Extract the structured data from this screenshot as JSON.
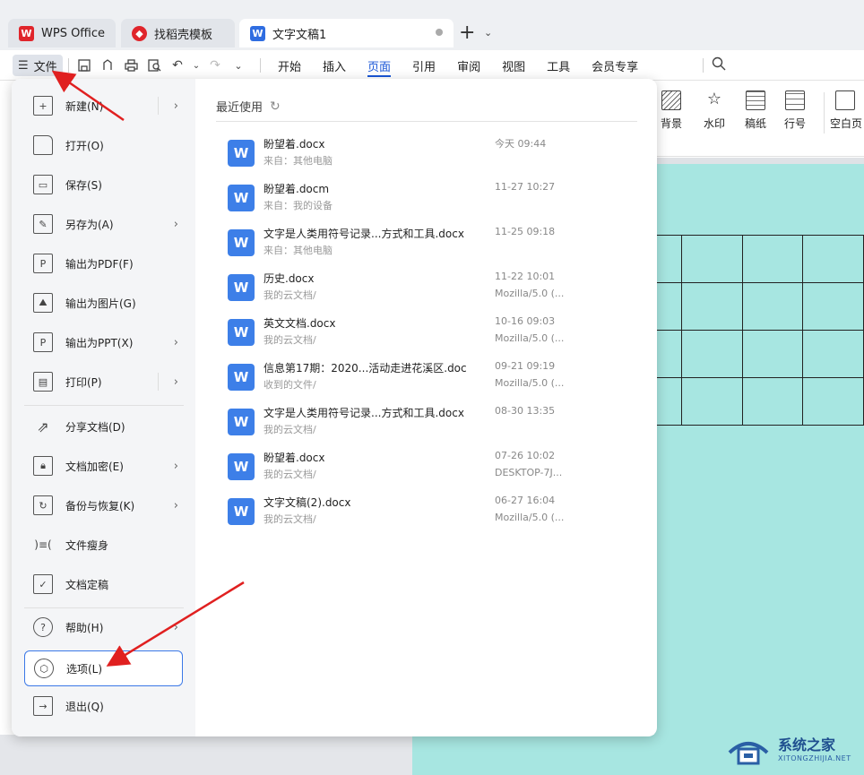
{
  "tabs": [
    {
      "label": "WPS Office",
      "icon": "wps-logo-icon"
    },
    {
      "label": "找稻壳模板",
      "icon": "docer-icon"
    },
    {
      "label": "文字文稿1",
      "icon": "word-doc-icon"
    }
  ],
  "menubar": {
    "file_label": "文件",
    "tabs": [
      "开始",
      "插入",
      "页面",
      "引用",
      "审阅",
      "视图",
      "工具",
      "会员专享"
    ],
    "active_tab": "页面"
  },
  "ribbon": {
    "buttons": [
      "背景",
      "水印",
      "稿纸",
      "行号",
      "空白页"
    ]
  },
  "file_menu": {
    "items": [
      {
        "label": "新建(N)",
        "icon": "new-file-icon",
        "submenu": true
      },
      {
        "label": "打开(O)",
        "icon": "folder-open-icon",
        "submenu": false
      },
      {
        "label": "保存(S)",
        "icon": "save-icon",
        "submenu": false
      },
      {
        "label": "另存为(A)",
        "icon": "save-as-icon",
        "submenu": true
      },
      {
        "label": "输出为PDF(F)",
        "icon": "export-pdf-icon",
        "submenu": false
      },
      {
        "label": "输出为图片(G)",
        "icon": "export-image-icon",
        "submenu": false
      },
      {
        "label": "输出为PPT(X)",
        "icon": "export-ppt-icon",
        "submenu": true
      },
      {
        "label": "打印(P)",
        "icon": "print-icon",
        "submenu": true
      },
      {
        "label": "分享文档(D)",
        "icon": "share-icon",
        "submenu": false
      },
      {
        "label": "文档加密(E)",
        "icon": "encrypt-icon",
        "submenu": true
      },
      {
        "label": "备份与恢复(K)",
        "icon": "backup-icon",
        "submenu": true
      },
      {
        "label": "文件瘦身",
        "icon": "slim-icon",
        "submenu": false
      },
      {
        "label": "文档定稿",
        "icon": "finalize-icon",
        "submenu": false
      },
      {
        "label": "帮助(H)",
        "icon": "help-icon",
        "submenu": true
      },
      {
        "label": "选项(L)",
        "icon": "options-icon",
        "submenu": false
      },
      {
        "label": "退出(Q)",
        "icon": "exit-icon",
        "submenu": false
      }
    ],
    "recent_title": "最近使用",
    "recent_files": [
      {
        "name": "盼望着.docx",
        "source": "来自：其他电脑",
        "date": "今天 09:44",
        "location": ""
      },
      {
        "name": "盼望着.docm",
        "source": "来自：我的设备",
        "date": "11-27 10:27",
        "location": ""
      },
      {
        "name": "文字是人类用符号记录...方式和工具.docx",
        "source": "来自：其他电脑",
        "date": "11-25 09:18",
        "location": ""
      },
      {
        "name": "历史.docx",
        "source": "我的云文档/",
        "date": "11-22 10:01",
        "location": "Mozilla/5.0 (..."
      },
      {
        "name": "英文文档.docx",
        "source": "我的云文档/",
        "date": "10-16 09:03",
        "location": "Mozilla/5.0 (..."
      },
      {
        "name": "信息第17期：2020...活动走进花溪区.doc",
        "source": "收到的文件/",
        "date": "09-21 09:19",
        "location": "Mozilla/5.0 (..."
      },
      {
        "name": "文字是人类用符号记录...方式和工具.docx",
        "source": "我的云文档/",
        "date": "08-30 13:35",
        "location": ""
      },
      {
        "name": "盼望着.docx",
        "source": "我的云文档/",
        "date": "07-26 10:02",
        "location": "DESKTOP-7J..."
      },
      {
        "name": "文字文稿(2).docx",
        "source": "我的云文档/",
        "date": "06-27 16:04",
        "location": "Mozilla/5.0 (..."
      }
    ]
  },
  "watermark": {
    "title": "系统之家",
    "subtitle": "XITONGZHIJIA.NET"
  },
  "colors": {
    "accent": "#1a56d6",
    "page_bg": "#a7e6e1",
    "annotation_arrow": "#e02020",
    "doc_icon": "#3d7fe8"
  }
}
